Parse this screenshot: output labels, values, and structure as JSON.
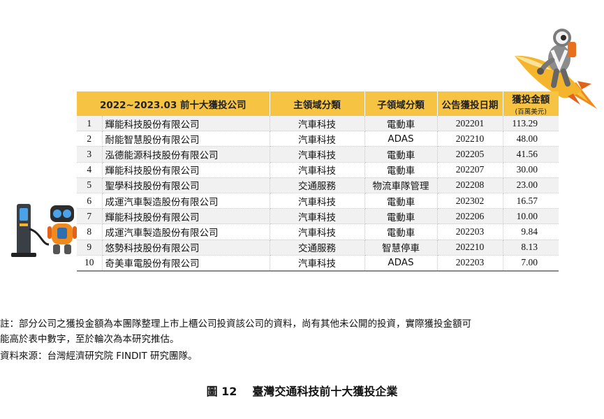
{
  "table": {
    "headers": {
      "company": "2022~2023.03 前十大獲投公司",
      "main_category": "主領域分類",
      "sub_category": "子領域分類",
      "date": "公告獲投日期",
      "amount": "獲投金額",
      "amount_unit": "(百萬美元)"
    },
    "rows": [
      {
        "rank": "1",
        "company": "輝能科技股份有限公司",
        "main": "汽車科技",
        "sub": "電動車",
        "date": "202201",
        "amount": "113.29"
      },
      {
        "rank": "2",
        "company": "耐能智慧股份有限公司",
        "main": "汽車科技",
        "sub": "ADAS",
        "date": "202210",
        "amount": "48.00"
      },
      {
        "rank": "3",
        "company": "泓德能源科技股份有限公司",
        "main": "汽車科技",
        "sub": "電動車",
        "date": "202205",
        "amount": "41.56"
      },
      {
        "rank": "4",
        "company": "輝能科技股份有限公司",
        "main": "汽車科技",
        "sub": "電動車",
        "date": "202207",
        "amount": "30.00"
      },
      {
        "rank": "5",
        "company": "聖學科技股份有限公司",
        "main": "交通服務",
        "sub": "物流車隊管理",
        "date": "202208",
        "amount": "23.00"
      },
      {
        "rank": "6",
        "company": "成運汽車製造股份有限公司",
        "main": "汽車科技",
        "sub": "電動車",
        "date": "202302",
        "amount": "16.57"
      },
      {
        "rank": "7",
        "company": "輝能科技股份有限公司",
        "main": "汽車科技",
        "sub": "電動車",
        "date": "202206",
        "amount": "10.00"
      },
      {
        "rank": "8",
        "company": "成運汽車製造股份有限公司",
        "main": "汽車科技",
        "sub": "電動車",
        "date": "202203",
        "amount": "9.84"
      },
      {
        "rank": "9",
        "company": "悠勢科技股份有限公司",
        "main": "交通服務",
        "sub": "智慧停車",
        "date": "202210",
        "amount": "8.13"
      },
      {
        "rank": "10",
        "company": "奇美車電股份有限公司",
        "main": "汽車科技",
        "sub": "ADAS",
        "date": "202203",
        "amount": "7.00"
      }
    ]
  },
  "notes": {
    "line1": "註：部分公司之獲投金額為本團隊整理上市上櫃公司投資該公司的資料，尚有其他未公開的投資，實際獲投金額可",
    "line2": "能高於表中數字，至於輪次為本研究推估。",
    "source": "資料來源：台灣經濟研究院 FINDIT 研究團隊。"
  },
  "caption": {
    "number": "圖 12",
    "title": "臺灣交通科技前十大獲投企業"
  },
  "colors": {
    "header_bg": "#f6c342",
    "row_stripe": "#f1f1f1"
  }
}
